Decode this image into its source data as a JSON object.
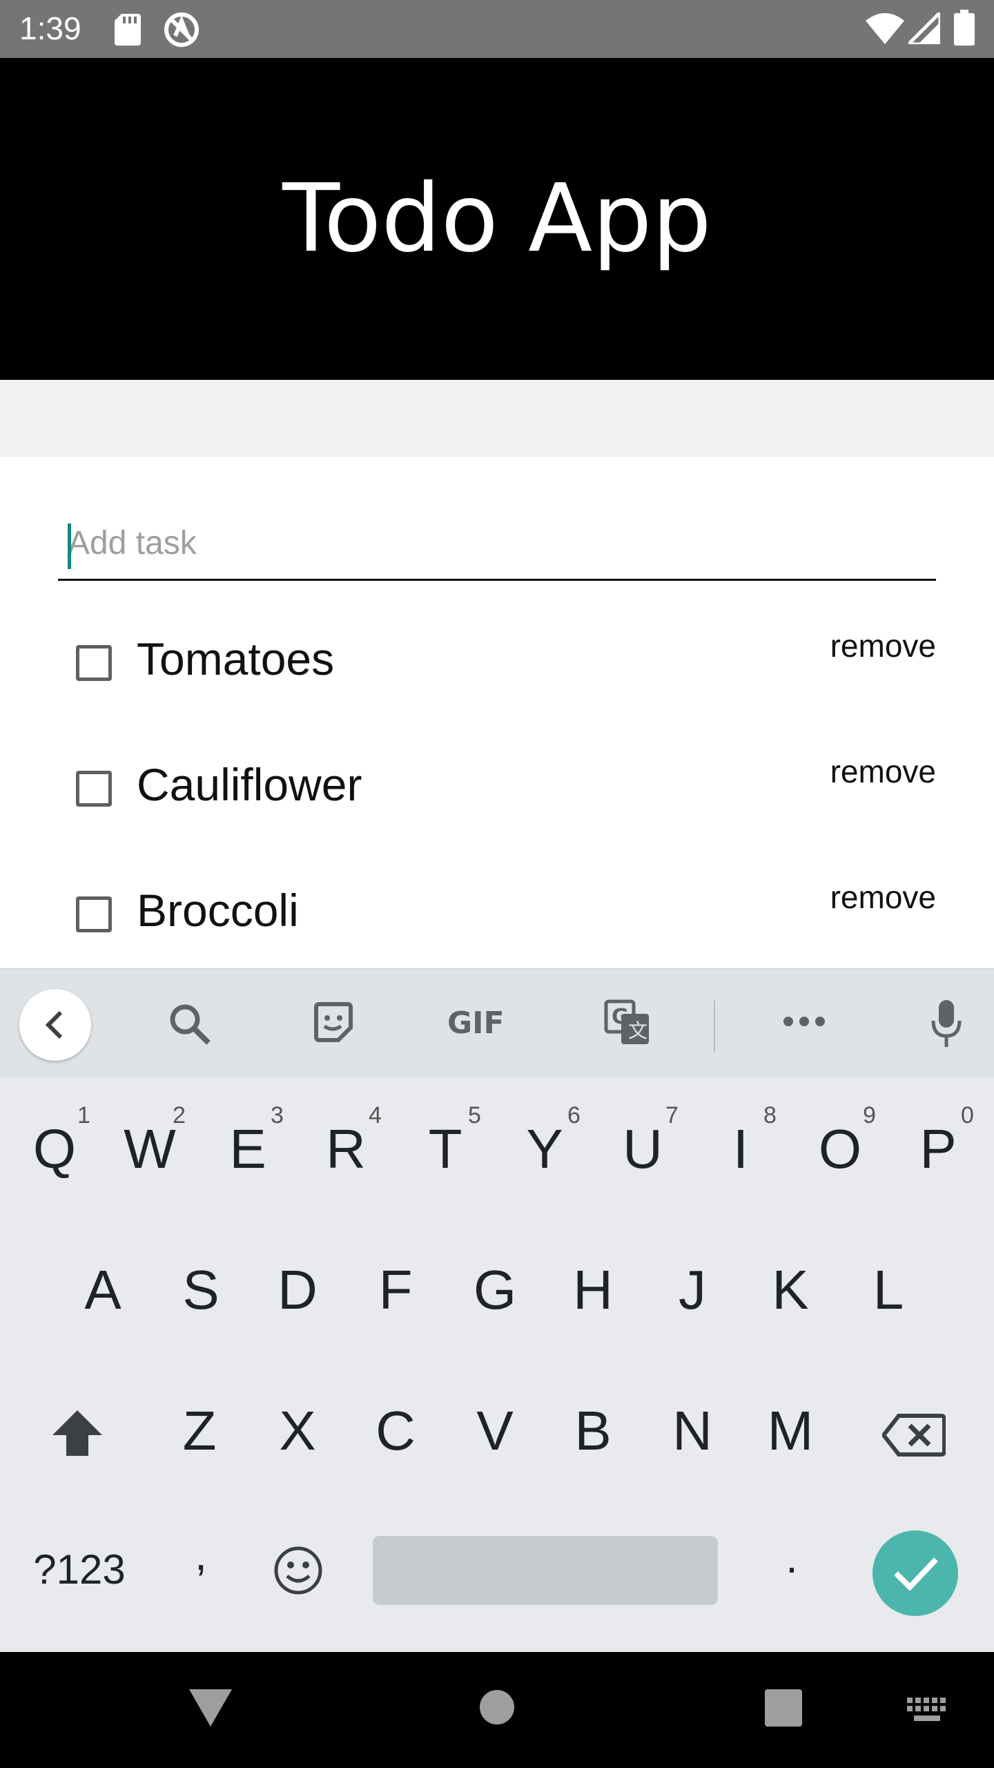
{
  "status_bar": {
    "time": "1:39",
    "icons": [
      "sd-card-icon",
      "sync-icon",
      "wifi-icon",
      "signal-icon",
      "battery-icon"
    ]
  },
  "app_bar": {
    "title": "Todo App"
  },
  "add_task": {
    "placeholder": "Add task",
    "value": ""
  },
  "tasks": [
    {
      "label": "Tomatoes",
      "checked": false,
      "action": "remove"
    },
    {
      "label": "Cauliflower",
      "checked": false,
      "action": "remove"
    },
    {
      "label": "Broccoli",
      "checked": false,
      "action": "remove"
    }
  ],
  "keyboard": {
    "toolbar": [
      "back-icon",
      "search-icon",
      "sticker-icon",
      "gif-icon",
      "translate-icon",
      "more-icon",
      "mic-icon"
    ],
    "gif_label": "GIF",
    "row1": [
      {
        "key": "Q",
        "hint": "1"
      },
      {
        "key": "W",
        "hint": "2"
      },
      {
        "key": "E",
        "hint": "3"
      },
      {
        "key": "R",
        "hint": "4"
      },
      {
        "key": "T",
        "hint": "5"
      },
      {
        "key": "Y",
        "hint": "6"
      },
      {
        "key": "U",
        "hint": "7"
      },
      {
        "key": "I",
        "hint": "8"
      },
      {
        "key": "O",
        "hint": "9"
      },
      {
        "key": "P",
        "hint": "0"
      }
    ],
    "row2": [
      "A",
      "S",
      "D",
      "F",
      "G",
      "H",
      "J",
      "K",
      "L"
    ],
    "row3": [
      "Z",
      "X",
      "C",
      "V",
      "B",
      "N",
      "M"
    ],
    "row4": {
      "symbols": "?123",
      "comma": ",",
      "period": "."
    }
  },
  "colors": {
    "status_bar": "#757575",
    "app_bar": "#000000",
    "caret": "#0f8a7e",
    "enter_key": "#4db6ac",
    "keyboard_bg": "#e8eaed"
  }
}
